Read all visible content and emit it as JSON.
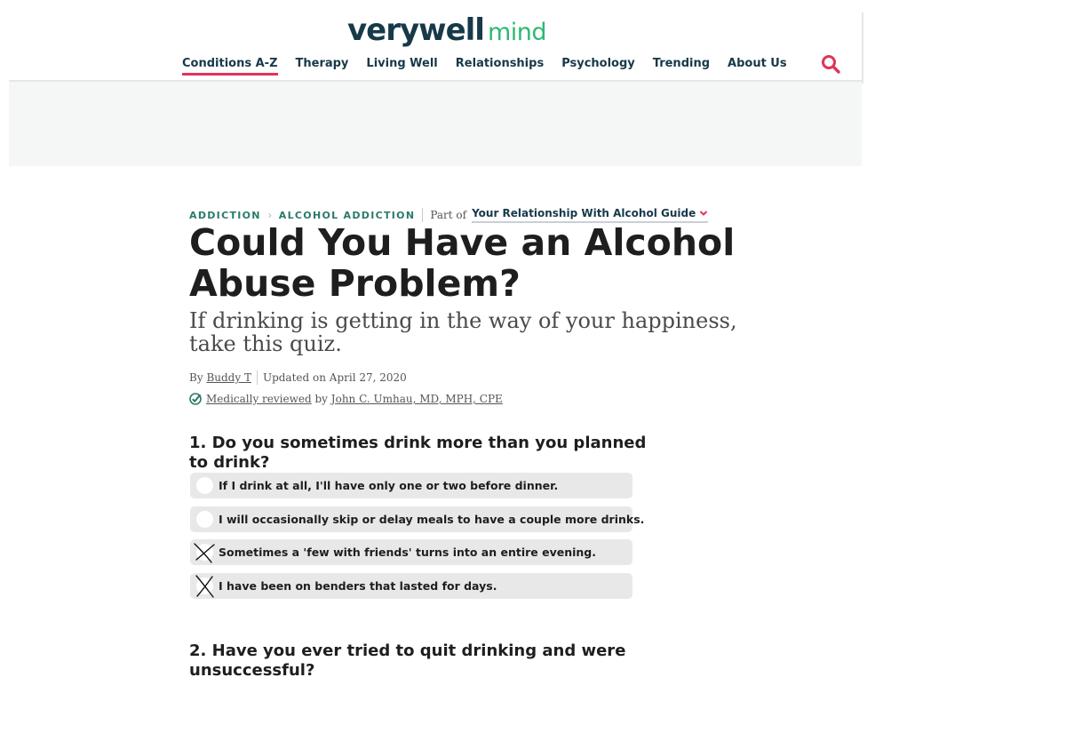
{
  "header": {
    "logo_main": "verywell",
    "logo_sub": "mind",
    "nav": [
      {
        "label": "Conditions A-Z",
        "active": true
      },
      {
        "label": "Therapy"
      },
      {
        "label": "Living Well"
      },
      {
        "label": "Relationships"
      },
      {
        "label": "Psychology"
      },
      {
        "label": "Trending"
      },
      {
        "label": "About Us"
      }
    ],
    "search_icon": "search-icon",
    "accent_color": "#e0345a"
  },
  "article": {
    "breadcrumb": [
      "ADDICTION",
      "ALCOHOL ADDICTION"
    ],
    "part_of": "Part of",
    "guide": "Your Relationship With Alcohol Guide",
    "title": "Could You Have an Alcohol Abuse Problem?",
    "subtitle": "If drinking is getting in the way of your happiness, take this quiz.",
    "byline": {
      "by": "By",
      "author": "Buddy T",
      "updated": "Updated on April 27, 2020"
    },
    "review": {
      "link": "Medically reviewed",
      "by": "by",
      "reviewer": "John C. Umhau, MD, MPH, CPE"
    }
  },
  "quiz": {
    "questions": [
      {
        "number": "1.",
        "text": "1. Do you sometimes drink more than you planned to drink?",
        "options": [
          {
            "label": "If I drink at all, I'll have only one or two before dinner.",
            "marked": false
          },
          {
            "label": "I will occasionally skip or delay meals to have a couple more drinks.",
            "marked": false
          },
          {
            "label": "Sometimes a 'few with friends' turns into an entire evening.",
            "marked": true
          },
          {
            "label": "I have been on benders that lasted for days.",
            "marked": true
          }
        ]
      },
      {
        "number": "2.",
        "text": "2. Have you ever tried to quit drinking and were unsuccessful?"
      }
    ]
  }
}
